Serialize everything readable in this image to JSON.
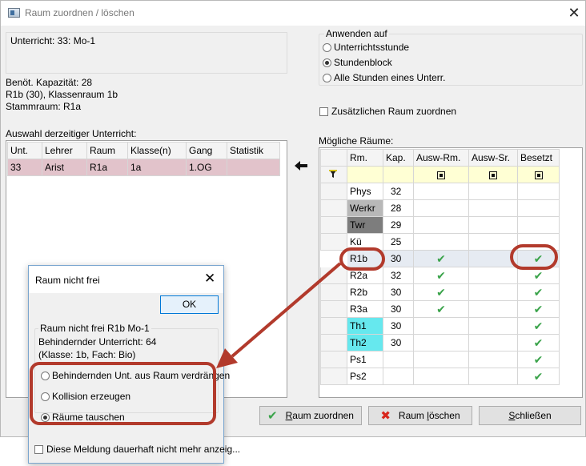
{
  "window": {
    "title": "Raum zuordnen / löschen",
    "icon": "app-window-icon",
    "close_glyph": "✕"
  },
  "info": {
    "unterricht": "Unterricht: 33: Mo-1",
    "kapazitaet": "Benöt. Kapazität: 28",
    "raum": "R1b (30), Klassenraum 1b",
    "stammraum": "Stammraum: R1a"
  },
  "anwenden": {
    "legend": "Anwenden auf",
    "options": [
      "Unterrichtsstunde",
      "Stundenblock",
      "Alle Stunden eines Unterr."
    ],
    "selected_index": 1
  },
  "zusatz_label": "Zusätzlichen Raum zuordnen",
  "auswahl": {
    "label": "Auswahl derzeitiger Unterricht:",
    "columns": [
      "Unt.",
      "Lehrer",
      "Raum",
      "Klasse(n)",
      "Gang",
      "Statistik"
    ],
    "rows": [
      [
        "33",
        "Arist",
        "R1a",
        "1a",
        "1.OG",
        ""
      ]
    ]
  },
  "rooms": {
    "label": "Mögliche Räume:",
    "columns": [
      "Rm.",
      "Kap.",
      "Ausw-Rm.",
      "Ausw-Sr.",
      "Besetzt"
    ],
    "rows": [
      {
        "name": "Phys",
        "kap": "32",
        "ausw_rm": false,
        "besetzt": false,
        "color": ""
      },
      {
        "name": "Werkr",
        "kap": "28",
        "ausw_rm": false,
        "besetzt": false,
        "color": "#b8b8b8"
      },
      {
        "name": "Twr",
        "kap": "29",
        "ausw_rm": false,
        "besetzt": false,
        "color": "#7d7d7d"
      },
      {
        "name": "Kü",
        "kap": "25",
        "ausw_rm": false,
        "besetzt": false,
        "color": ""
      },
      {
        "name": "R1b",
        "kap": "30",
        "ausw_rm": true,
        "besetzt": true,
        "color": ""
      },
      {
        "name": "R2a",
        "kap": "32",
        "ausw_rm": true,
        "besetzt": true,
        "color": ""
      },
      {
        "name": "R2b",
        "kap": "30",
        "ausw_rm": true,
        "besetzt": true,
        "color": ""
      },
      {
        "name": "R3a",
        "kap": "30",
        "ausw_rm": true,
        "besetzt": true,
        "color": ""
      },
      {
        "name": "Th1",
        "kap": "30",
        "ausw_rm": false,
        "besetzt": true,
        "color": "#66e8ee"
      },
      {
        "name": "Th2",
        "kap": "30",
        "ausw_rm": false,
        "besetzt": true,
        "color": "#66e8ee"
      },
      {
        "name": "Ps1",
        "kap": "",
        "ausw_rm": false,
        "besetzt": true,
        "color": ""
      },
      {
        "name": "Ps2",
        "kap": "",
        "ausw_rm": false,
        "besetzt": true,
        "color": ""
      }
    ],
    "selected_index": 4
  },
  "buttons": {
    "zuordnen": {
      "pre": "",
      "u": "R",
      "post": "aum zuordnen"
    },
    "loeschen": {
      "pre": "Raum ",
      "u": "l",
      "post": "öschen"
    },
    "schliessen": {
      "pre": "",
      "u": "S",
      "post": "chließen"
    }
  },
  "popup": {
    "title": "Raum nicht frei",
    "close_glyph": "✕",
    "ok": "OK",
    "legend": "Raum nicht frei  R1b  Mo-1",
    "behindernd": "Behindernder Unterricht: 64",
    "klasse_fach": "(Klasse: 1b, Fach: Bio)",
    "options": [
      "Behindernden Unt. aus Raum verdrängen",
      "Kollision erzeugen",
      "Räume tauschen"
    ],
    "selected_index": 2,
    "dont_show": "Diese Meldung dauerhaft nicht mehr anzeig..."
  },
  "colors": {
    "selected_row": "#e2c3cb",
    "annotation": "#b23a2c",
    "filter_row": "#ffffd4",
    "check": "#3aa34a"
  }
}
